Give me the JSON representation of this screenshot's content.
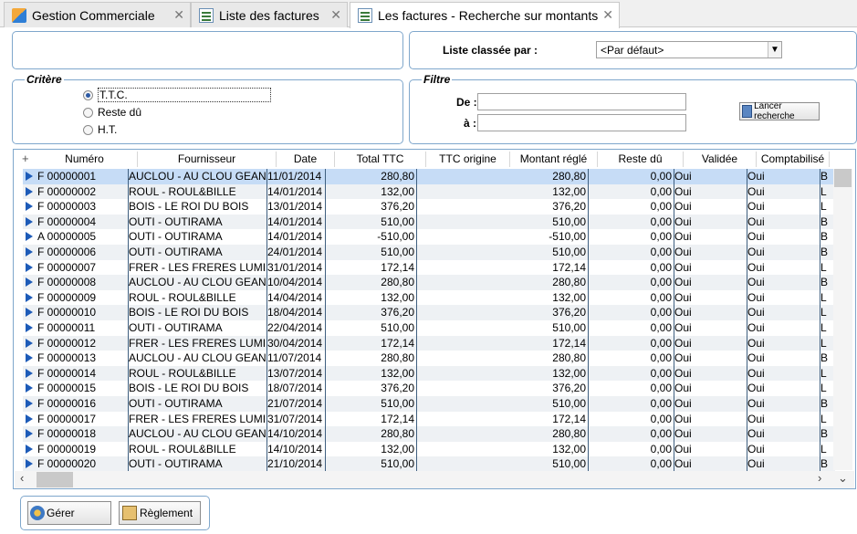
{
  "tabs": [
    {
      "label": "Gestion Commerciale",
      "icon": "app-icon"
    },
    {
      "label": "Liste des factures",
      "icon": "document-icon"
    },
    {
      "label": "Les factures - Recherche sur montants",
      "icon": "document-icon"
    }
  ],
  "close_glyph": "✕",
  "sort": {
    "label": "Liste classée par :",
    "value": "<Par défaut>"
  },
  "criteria": {
    "title": "Critère",
    "options": [
      {
        "label": "T.T.C.",
        "selected": true
      },
      {
        "label": "Reste dû",
        "selected": false
      },
      {
        "label": "H.T.",
        "selected": false
      }
    ]
  },
  "filter": {
    "title": "Filtre",
    "from_label": "De :",
    "to_label": "à :",
    "from_value": "",
    "to_value": "",
    "search_button": "Lancer recherche"
  },
  "table": {
    "columns": [
      "Numéro",
      "Fournisseur",
      "Date",
      "Total TTC",
      "TTC origine",
      "Montant réglé",
      "Reste dû",
      "Validée",
      "Comptabilisé"
    ],
    "rows": [
      [
        "F 00000001",
        "AUCLOU - AU CLOU GEANT",
        "11/01/2014",
        "280,80",
        "",
        "280,80",
        "0,00",
        "Oui",
        "Oui",
        "B"
      ],
      [
        "F 00000002",
        "ROUL - ROUL&BILLE",
        "14/01/2014",
        "132,00",
        "",
        "132,00",
        "0,00",
        "Oui",
        "Oui",
        "L"
      ],
      [
        "F 00000003",
        "BOIS - LE ROI DU BOIS",
        "13/01/2014",
        "376,20",
        "",
        "376,20",
        "0,00",
        "Oui",
        "Oui",
        "L"
      ],
      [
        "F 00000004",
        "OUTI - OUTIRAMA",
        "14/01/2014",
        "510,00",
        "",
        "510,00",
        "0,00",
        "Oui",
        "Oui",
        "B"
      ],
      [
        "A 00000005",
        "OUTI - OUTIRAMA",
        "14/01/2014",
        "-510,00",
        "",
        "-510,00",
        "0,00",
        "Oui",
        "Oui",
        "B"
      ],
      [
        "F 00000006",
        "OUTI - OUTIRAMA",
        "24/01/2014",
        "510,00",
        "",
        "510,00",
        "0,00",
        "Oui",
        "Oui",
        "B"
      ],
      [
        "F 00000007",
        "FRER - LES FRERES LUMIERE",
        "31/01/2014",
        "172,14",
        "",
        "172,14",
        "0,00",
        "Oui",
        "Oui",
        "L"
      ],
      [
        "F 00000008",
        "AUCLOU - AU CLOU GEANT",
        "10/04/2014",
        "280,80",
        "",
        "280,80",
        "0,00",
        "Oui",
        "Oui",
        "B"
      ],
      [
        "F 00000009",
        "ROUL - ROUL&BILLE",
        "14/04/2014",
        "132,00",
        "",
        "132,00",
        "0,00",
        "Oui",
        "Oui",
        "L"
      ],
      [
        "F 00000010",
        "BOIS - LE ROI DU BOIS",
        "18/04/2014",
        "376,20",
        "",
        "376,20",
        "0,00",
        "Oui",
        "Oui",
        "L"
      ],
      [
        "F 00000011",
        "OUTI - OUTIRAMA",
        "22/04/2014",
        "510,00",
        "",
        "510,00",
        "0,00",
        "Oui",
        "Oui",
        "L"
      ],
      [
        "F 00000012",
        "FRER - LES FRERES LUMIERE",
        "30/04/2014",
        "172,14",
        "",
        "172,14",
        "0,00",
        "Oui",
        "Oui",
        "L"
      ],
      [
        "F 00000013",
        "AUCLOU - AU CLOU GEANT",
        "11/07/2014",
        "280,80",
        "",
        "280,80",
        "0,00",
        "Oui",
        "Oui",
        "B"
      ],
      [
        "F 00000014",
        "ROUL - ROUL&BILLE",
        "13/07/2014",
        "132,00",
        "",
        "132,00",
        "0,00",
        "Oui",
        "Oui",
        "L"
      ],
      [
        "F 00000015",
        "BOIS - LE ROI DU BOIS",
        "18/07/2014",
        "376,20",
        "",
        "376,20",
        "0,00",
        "Oui",
        "Oui",
        "L"
      ],
      [
        "F 00000016",
        "OUTI - OUTIRAMA",
        "21/07/2014",
        "510,00",
        "",
        "510,00",
        "0,00",
        "Oui",
        "Oui",
        "B"
      ],
      [
        "F 00000017",
        "FRER - LES FRERES LUMIERE",
        "31/07/2014",
        "172,14",
        "",
        "172,14",
        "0,00",
        "Oui",
        "Oui",
        "L"
      ],
      [
        "F 00000018",
        "AUCLOU - AU CLOU GEANT",
        "14/10/2014",
        "280,80",
        "",
        "280,80",
        "0,00",
        "Oui",
        "Oui",
        "B"
      ],
      [
        "F 00000019",
        "ROUL - ROUL&BILLE",
        "14/10/2014",
        "132,00",
        "",
        "132,00",
        "0,00",
        "Oui",
        "Oui",
        "L"
      ],
      [
        "F 00000020",
        "OUTI - OUTIRAMA",
        "21/10/2014",
        "510,00",
        "",
        "510,00",
        "0,00",
        "Oui",
        "Oui",
        "B"
      ]
    ],
    "selected_row": 0
  },
  "buttons": {
    "manage": "Gérer",
    "payment": "Règlement"
  },
  "colors": {
    "accent": "#7fa7cc",
    "selected_row": "#c6dcf6",
    "flag": "#1d5bb8"
  }
}
